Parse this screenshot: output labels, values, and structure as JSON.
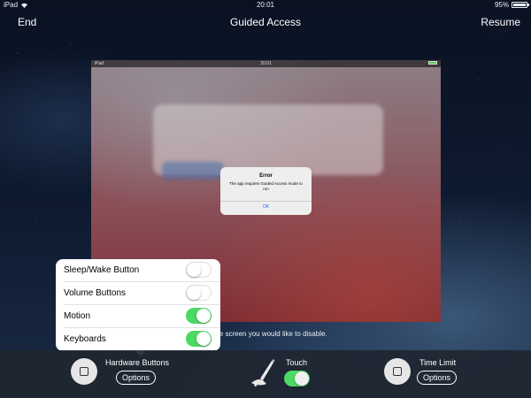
{
  "status_bar": {
    "carrier": "iPad",
    "time": "20:01",
    "battery": "95%",
    "battery_level": 0.95
  },
  "nav": {
    "end_label": "End",
    "title": "Guided Access",
    "resume_label": "Resume"
  },
  "preview": {
    "status_carrier": "iPad",
    "status_time": "20:01",
    "alert": {
      "title": "Error",
      "message": "The app requires Guided Access mode to run",
      "ok_label": "OK"
    }
  },
  "hint_text": "on the screen you would like to disable.",
  "popover": {
    "rows": [
      {
        "label": "Sleep/Wake Button",
        "on": false
      },
      {
        "label": "Volume Buttons",
        "on": false
      },
      {
        "label": "Motion",
        "on": true
      },
      {
        "label": "Keyboards",
        "on": true
      }
    ]
  },
  "bottom_bar": {
    "hardware_label": "Hardware Buttons",
    "hardware_options": "Options",
    "touch_label": "Touch",
    "touch_on": true,
    "time_limit_label": "Time Limit",
    "time_limit_options": "Options"
  },
  "colors": {
    "switch_on": "#4cd964",
    "alert_link": "#1a6ad9"
  },
  "icons": {
    "pen": "pen-hand-icon",
    "hardware": "square-icon",
    "time_limit": "square-icon",
    "wifi": "wifi-icon",
    "battery": "battery-icon"
  }
}
